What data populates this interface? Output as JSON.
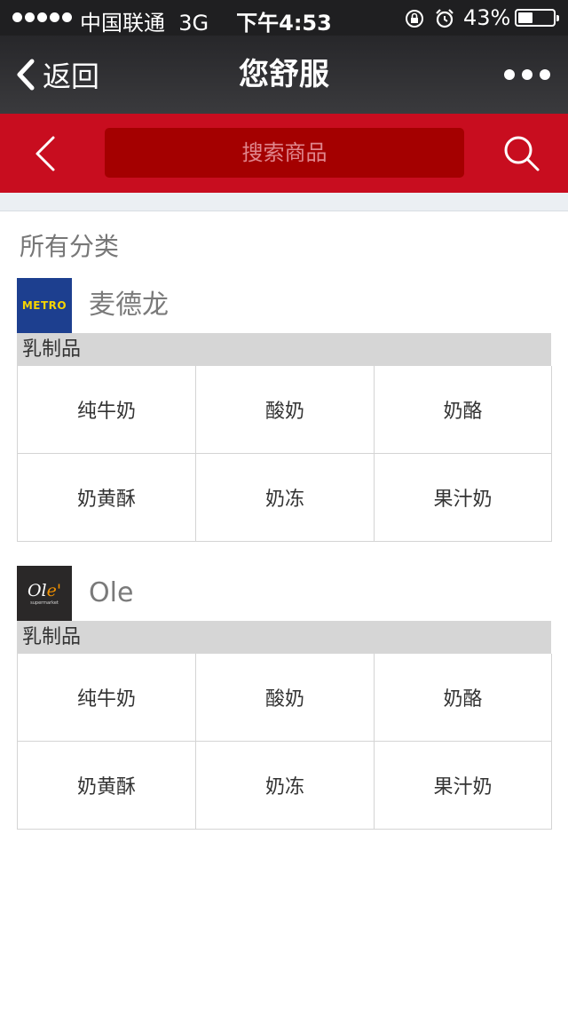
{
  "status_bar": {
    "carrier": "中国联通",
    "network": "3G",
    "time": "下午4:53",
    "battery_percent": "43%",
    "battery_level": 0.43,
    "icons": [
      "signal-dots-icon",
      "rotation-lock-icon",
      "alarm-icon",
      "battery-icon"
    ]
  },
  "nav": {
    "back_label": "返回",
    "title": "您舒服",
    "more_icon": "more-dots-icon"
  },
  "search": {
    "placeholder": "搜索商品",
    "back_icon": "chevron-left-icon",
    "search_icon": "search-icon"
  },
  "section_title": "所有分类",
  "stores": [
    {
      "name": "麦德龙",
      "logo_text": "METRO",
      "category": "乳制品",
      "items": [
        "纯牛奶",
        "酸奶",
        "奶酪",
        "奶黄酥",
        "奶冻",
        "果汁奶"
      ]
    },
    {
      "name": "Ole",
      "logo_text": "Ole'",
      "logo_subtext": "supermarket",
      "category": "乳制品",
      "items": [
        "纯牛奶",
        "酸奶",
        "奶酪",
        "奶黄酥",
        "奶冻",
        "果汁奶"
      ]
    }
  ],
  "colors": {
    "brand_red": "#c80d1f",
    "search_box": "#a40000",
    "nav_dark": "#2c2c2f",
    "metro_blue": "#1d3f8f",
    "metro_yellow": "#f6d400",
    "ole_orange": "#f39200"
  }
}
